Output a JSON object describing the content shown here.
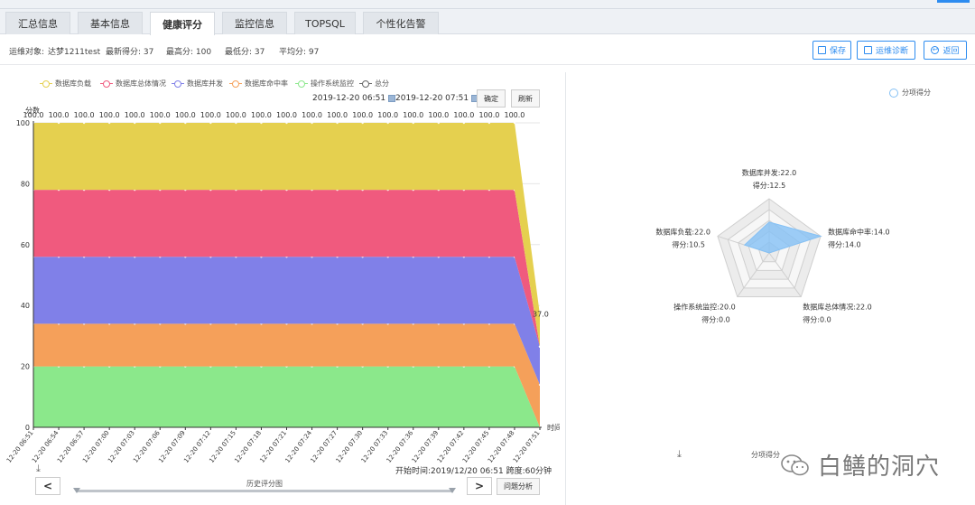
{
  "tabs": [
    {
      "label": "汇总信息",
      "active": false
    },
    {
      "label": "基本信息",
      "active": false
    },
    {
      "label": "健康评分",
      "active": true
    },
    {
      "label": "监控信息",
      "active": false
    },
    {
      "label": "TOPSQL",
      "active": false
    },
    {
      "label": "个性化告警",
      "active": false
    }
  ],
  "info": {
    "target_label": "运维对象:",
    "target_value": "达梦1211test",
    "latest_score": "最新得分: 37",
    "max_score": "最高分: 100",
    "min_score": "最低分: 37",
    "avg_score": "平均分: 97"
  },
  "toolbar": {
    "save_label": "保存",
    "diagnose_label": "运维诊断",
    "back_label": "返回"
  },
  "filter": {
    "start_time": "2019-12-20 06:51",
    "end_time": "2019-12-20 07:51",
    "confirm_label": "确定",
    "refresh_label": "刷新"
  },
  "footer": {
    "span_info": "开始时间:2019/12/20 06:51 跨度:60分钟",
    "prev_label": "<",
    "next_label": ">",
    "slider_label": "历史评分图",
    "analyze_label": "问题分析",
    "radar_footer_label": "分项得分",
    "watermark_text": "白鳝的洞穴"
  },
  "colors": {
    "accent": "#2d8cf0",
    "db_load": "#e5d04f",
    "db_overall": "#f05a7e",
    "db_concurrency": "#8080e8",
    "db_hit": "#f5a05a",
    "os_monitor": "#8be88b",
    "total": "#666666",
    "radar_fill": "#85c1f5"
  },
  "chart_data": [
    {
      "type": "area",
      "stacked": true,
      "ylabel": "分数",
      "xlabel": "时间",
      "ylim": [
        0,
        100
      ],
      "yticks": [
        0,
        20,
        40,
        60,
        80,
        100
      ],
      "x": [
        "12-20 06:51",
        "12-20 06:54",
        "12-20 06:57",
        "12-20 07:00",
        "12-20 07:03",
        "12-20 07:06",
        "12-20 07:09",
        "12-20 07:12",
        "12-20 07:15",
        "12-20 07:18",
        "12-20 07:21",
        "12-20 07:24",
        "12-20 07:27",
        "12-20 07:30",
        "12-20 07:33",
        "12-20 07:36",
        "12-20 07:39",
        "12-20 07:42",
        "12-20 07:45",
        "12-20 07:48",
        "12-20 07:51"
      ],
      "series": [
        {
          "name": "操作系统监控",
          "values": [
            20,
            20,
            20,
            20,
            20,
            20,
            20,
            20,
            20,
            20,
            20,
            20,
            20,
            20,
            20,
            20,
            20,
            20,
            20,
            20,
            0
          ]
        },
        {
          "name": "数据库命中率",
          "values": [
            14,
            14,
            14,
            14,
            14,
            14,
            14,
            14,
            14,
            14,
            14,
            14,
            14,
            14,
            14,
            14,
            14,
            14,
            14,
            14,
            14
          ]
        },
        {
          "name": "数据库并发",
          "values": [
            22,
            22,
            22,
            22,
            22,
            22,
            22,
            22,
            22,
            22,
            22,
            22,
            22,
            22,
            22,
            22,
            22,
            22,
            22,
            22,
            12.5
          ]
        },
        {
          "name": "数据库总体情况",
          "values": [
            22,
            22,
            22,
            22,
            22,
            22,
            22,
            22,
            22,
            22,
            22,
            22,
            22,
            22,
            22,
            22,
            22,
            22,
            22,
            22,
            0
          ]
        },
        {
          "name": "数据库负载",
          "values": [
            22,
            22,
            22,
            22,
            22,
            22,
            22,
            22,
            22,
            22,
            22,
            22,
            22,
            22,
            22,
            22,
            22,
            22,
            22,
            22,
            10.5
          ]
        }
      ],
      "total": {
        "name": "总分",
        "labels": [
          "100.0",
          "100.0",
          "100.0",
          "100.0",
          "100.0",
          "100.0",
          "100.0",
          "100.0",
          "100.0",
          "100.0",
          "100.0",
          "100.0",
          "100.0",
          "100.0",
          "100.0",
          "100.0",
          "100.0",
          "100.0",
          "100.0",
          "100.0",
          "37.0"
        ]
      },
      "legend": [
        "数据库负载",
        "数据库总体情况",
        "数据库并发",
        "数据库命中率",
        "操作系统监控",
        "总分"
      ]
    },
    {
      "type": "radar",
      "legend": [
        "分项得分"
      ],
      "axes": [
        {
          "label": "数据库并发:22.0",
          "score_label": "得分:12.5",
          "max": 22,
          "value": 12.5
        },
        {
          "label": "数据库命中率:14.0",
          "score_label": "得分:14.0",
          "max": 14,
          "value": 14
        },
        {
          "label": "数据库总体情况:22.0",
          "score_label": "得分:0.0",
          "max": 22,
          "value": 0
        },
        {
          "label": "操作系统监控:20.0",
          "score_label": "得分:0.0",
          "max": 20,
          "value": 0
        },
        {
          "label": "数据库负载:22.0",
          "score_label": "得分:10.5",
          "max": 22,
          "value": 10.5
        }
      ]
    }
  ]
}
